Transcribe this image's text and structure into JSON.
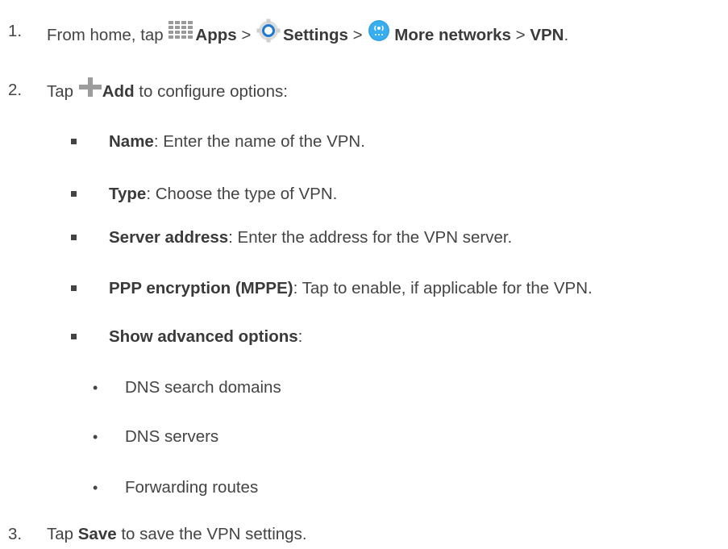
{
  "steps": [
    {
      "num": "1.",
      "parts": [
        {
          "t": "From home, tap ",
          "b": false
        },
        {
          "t": "",
          "icon": "apps-grid-icon"
        },
        {
          "t": "Apps",
          "b": true
        },
        {
          "t": " > ",
          "b": false
        },
        {
          "t": "",
          "icon": "settings-gear-icon"
        },
        {
          "t": "Settings",
          "b": true
        },
        {
          "t": " > ",
          "b": false
        },
        {
          "t": "",
          "icon": "more-networks-icon"
        },
        {
          "t": "More networks",
          "b": true
        },
        {
          "t": " > ",
          "b": false
        },
        {
          "t": "VPN",
          "b": true
        },
        {
          "t": ".",
          "b": false
        }
      ]
    },
    {
      "num": "2.",
      "parts": [
        {
          "t": "Tap ",
          "b": false
        },
        {
          "t": "",
          "icon": "add-plus-icon"
        },
        {
          "t": "Add",
          "b": true
        },
        {
          "t": " to configure options:",
          "b": false
        }
      ]
    },
    {
      "num": "3.",
      "parts": [
        {
          "t": "Tap ",
          "b": false
        },
        {
          "t": "Save",
          "b": true
        },
        {
          "t": " to save the VPN settings.",
          "b": false
        }
      ]
    }
  ],
  "options": [
    {
      "label": "Name",
      "desc": ": Enter the name of the VPN."
    },
    {
      "label": "Type",
      "desc": ": Choose the type of VPN."
    },
    {
      "label": "Server address",
      "desc": ": Enter the address for the VPN server."
    },
    {
      "label": "PPP encryption (MPPE)",
      "desc": ": Tap to enable, if applicable for the VPN."
    },
    {
      "label": "Show advanced options",
      "desc": ":"
    }
  ],
  "bullet_glyph": "•",
  "advanced": [
    "DNS search domains",
    "DNS servers",
    "Forwarding routes"
  ]
}
